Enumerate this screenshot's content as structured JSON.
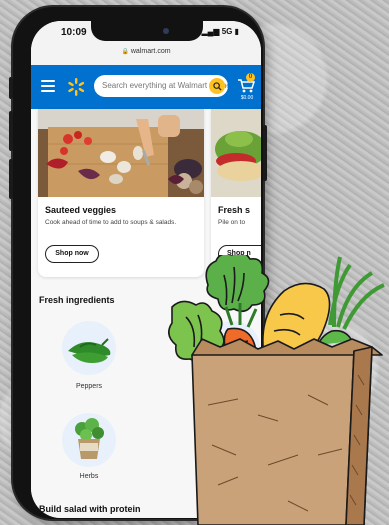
{
  "status_bar": {
    "time": "10:09",
    "network": "5G",
    "url": "walmart.com"
  },
  "header": {
    "search_placeholder": "Search everything at Walmart online and in store",
    "cart_count": "0",
    "cart_price": "$0.00"
  },
  "cards": [
    {
      "title": "Sauteed veggies",
      "subtitle": "Cook ahead of time to add to soups & salads.",
      "button": "Shop now"
    },
    {
      "title": "Fresh s",
      "subtitle": "Pile on to",
      "button": "Shop n"
    }
  ],
  "sections": {
    "fresh_ingredients": "Fresh ingredients",
    "build_salad": "Build salad with protein"
  },
  "ingredients": [
    {
      "label": "Peppers"
    },
    {
      "label": "Herbs"
    }
  ],
  "colors": {
    "brand_blue": "#0071ce",
    "brand_yellow": "#ffc220"
  }
}
